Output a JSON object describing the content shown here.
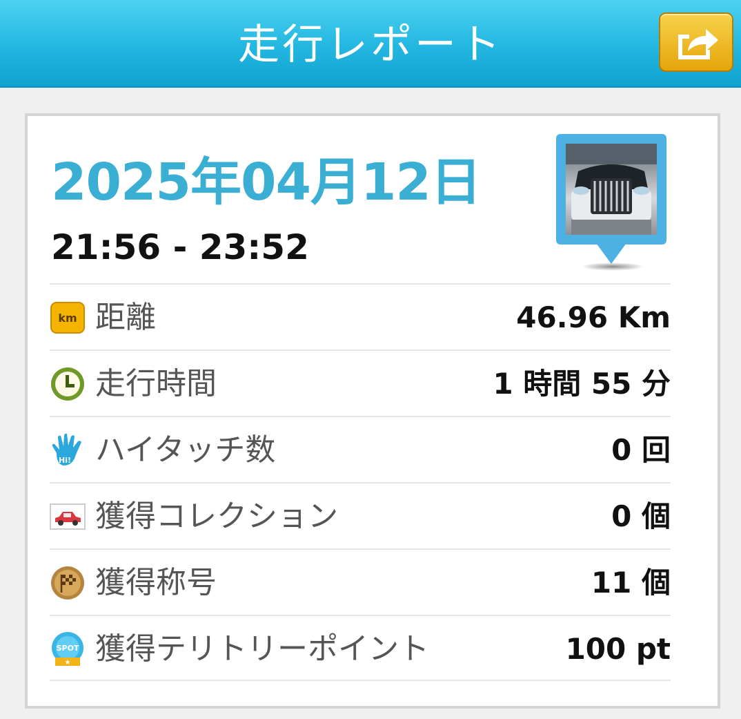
{
  "header": {
    "title": "走行レポート",
    "share_icon": "share-icon"
  },
  "report": {
    "date": "2025年04月12日",
    "time_range": "21:56 - 23:52",
    "car_image_icon": "car-photo"
  },
  "stats": [
    {
      "icon": "km-icon",
      "label": "距離",
      "value": "46.96 Km"
    },
    {
      "icon": "clock-icon",
      "label": "走行時間",
      "value": "1 時間 55 分"
    },
    {
      "icon": "high-five-hand-icon",
      "label": "ハイタッチ数",
      "value": "0 回"
    },
    {
      "icon": "car-card-icon",
      "label": "獲得コレクション",
      "value": "0 個"
    },
    {
      "icon": "checkered-flag-medal-icon",
      "label": "獲得称号",
      "value": "11 個"
    },
    {
      "icon": "spot-badge-icon",
      "label": "獲得テリトリーポイント",
      "value": "100 pt"
    }
  ],
  "colors": {
    "header": "#22b6e0",
    "date": "#3aaed3",
    "share_button": "#e6a50b"
  }
}
